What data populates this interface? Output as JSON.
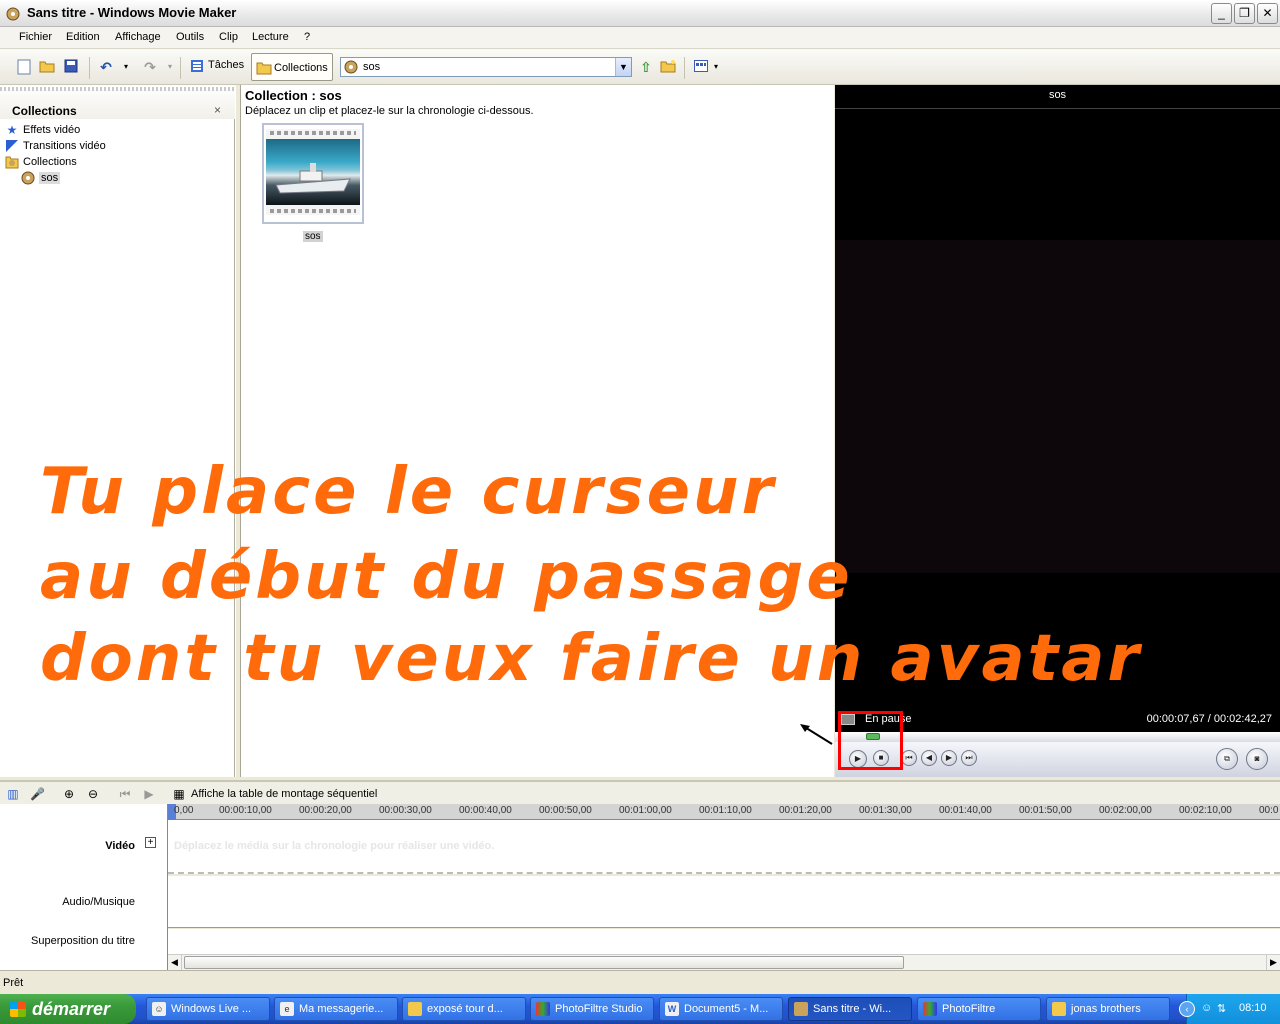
{
  "window": {
    "title": "Sans titre - Windows Movie Maker"
  },
  "menu": [
    "Fichier",
    "Edition",
    "Affichage",
    "Outils",
    "Clip",
    "Lecture",
    "?"
  ],
  "toolbar": {
    "tasks_label": "Tâches",
    "collections_label": "Collections",
    "collection_select_value": "sos"
  },
  "collections_pane": {
    "title": "Collections",
    "close": "×",
    "items": [
      "Effets vidéo",
      "Transitions vidéo",
      "Collections",
      "sos"
    ]
  },
  "content": {
    "title": "Collection : sos",
    "subtitle": "Déplacez un clip et placez-le sur la chronologie ci-dessous.",
    "clip_label": "sos"
  },
  "preview": {
    "title": "sos",
    "status": "En pause",
    "time": "00:00:07,67 / 00:02:42,27",
    "progress_fraction": 0.047
  },
  "overlay": {
    "lines": [
      "Tu place le curseur",
      "au début du passage",
      "dont tu veux faire un avatar"
    ],
    "color": "#ff6a0a"
  },
  "timeline": {
    "storyboard_label": "Affiche la table de montage séquentiel",
    "ticks": [
      "0,00",
      "00:00:10,00",
      "00:00:20,00",
      "00:00:30,00",
      "00:00:40,00",
      "00:00:50,00",
      "00:01:00,00",
      "00:01:10,00",
      "00:01:20,00",
      "00:01:30,00",
      "00:01:40,00",
      "00:01:50,00",
      "00:02:00,00",
      "00:02:10,00",
      "00:0"
    ],
    "tracks": {
      "video": "Vidéo",
      "expand": "+",
      "audio": "Audio/Musique",
      "title": "Superposition du titre"
    },
    "video_hint": "Déplacez le média sur la chronologie pour réaliser une vidéo."
  },
  "status_bar": {
    "text": "Prêt"
  },
  "taskbar": {
    "start": "démarrer",
    "tasks": [
      "Windows Live ...",
      "Ma messagerie...",
      "exposé tour d...",
      "PhotoFiltre Studio",
      "Document5 - M...",
      "Sans titre - Wi...",
      "PhotoFiltre",
      "jonas brothers"
    ],
    "clock": "08:10"
  }
}
